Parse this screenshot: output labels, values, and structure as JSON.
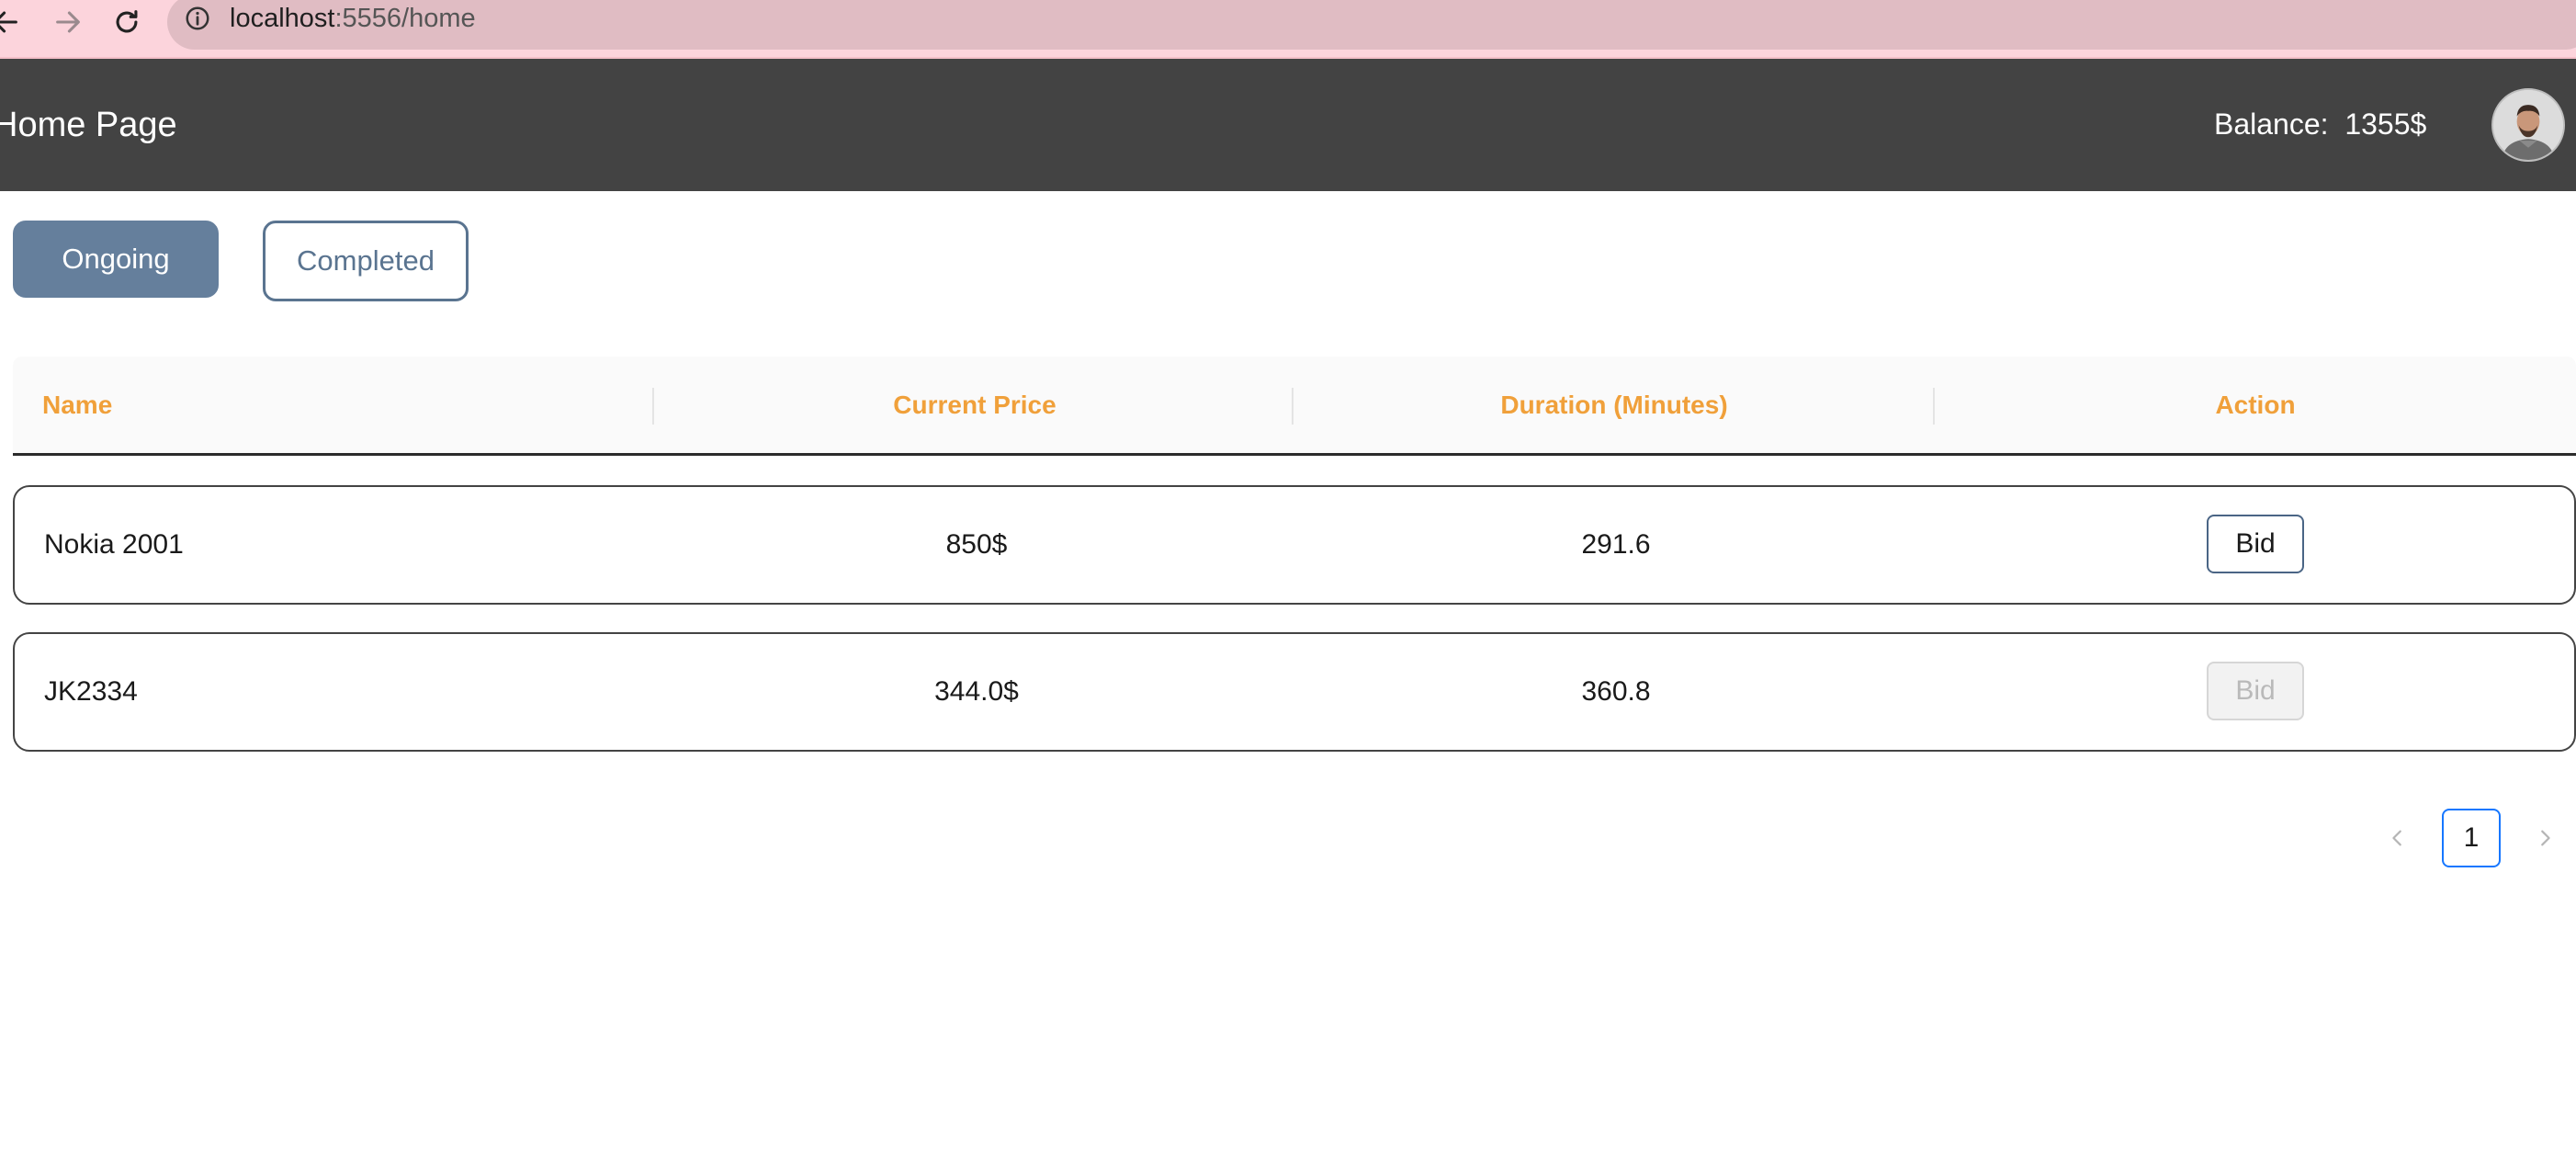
{
  "browser": {
    "url_host": "localhost",
    "url_rest": ":5556/home"
  },
  "header": {
    "title": "Home Page",
    "balance_label": "Balance:",
    "balance_value": "1355$"
  },
  "tabs": [
    {
      "label": "Ongoing",
      "active": true
    },
    {
      "label": "Completed",
      "active": false
    }
  ],
  "table": {
    "columns": [
      "Name",
      "Current Price",
      "Duration (Minutes)",
      "Action"
    ],
    "rows": [
      {
        "name": "Nokia 2001",
        "price": "850$",
        "duration": "291.6",
        "action": "Bid",
        "enabled": true
      },
      {
        "name": "JK2334",
        "price": "344.0$",
        "duration": "360.8",
        "action": "Bid",
        "enabled": false
      }
    ]
  },
  "pagination": {
    "current_page": "1"
  },
  "colors": {
    "header_bg": "#434343",
    "accent": "#657f9c",
    "column_header": "#f0a03a",
    "pager_active": "#1677ff"
  }
}
